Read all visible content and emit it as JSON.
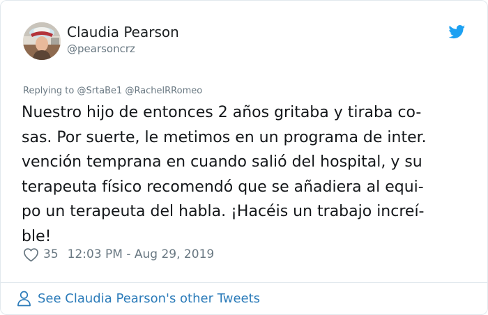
{
  "author": {
    "display_name": "Claudia Pearson",
    "handle": "@pearsoncrz"
  },
  "icons": {
    "brand": "twitter-bird-icon",
    "like": "heart-icon",
    "profile": "person-icon"
  },
  "colors": {
    "brand_blue": "#1da1f2",
    "link_blue": "#2b7bb9",
    "muted_gray": "#697882",
    "text": "#14171a"
  },
  "reply": {
    "prefix": "Replying to",
    "mentions": [
      "@SrtaBe1",
      "@RachelRRomeo"
    ]
  },
  "tweet": {
    "lines": [
      "Nuestro hijo de entonces 2 años gritaba y tiraba co-",
      "sas. Por suerte, le metimos en un programa de inter.",
      "vención temprana en cuando salió del hospital, y su",
      "terapeuta físico recomendó que se añadiera al equi-",
      "po un terapeuta del habla. ¡Hacéis un trabajo increí-",
      "ble!"
    ],
    "likes": "35",
    "timestamp": "12:03 PM - Aug 29, 2019"
  },
  "footer": {
    "link_label": "See Claudia Pearson's other Tweets"
  }
}
